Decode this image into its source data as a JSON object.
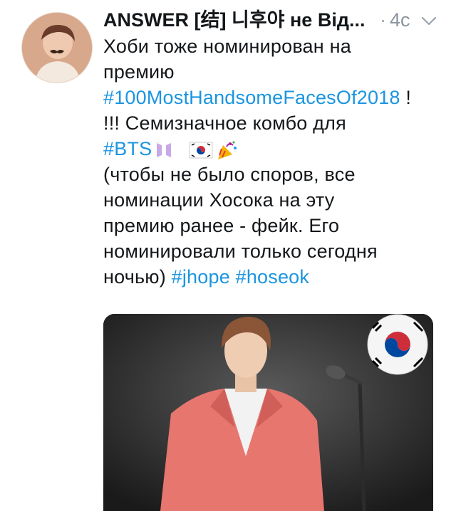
{
  "tweet": {
    "author_name": "ANSWER [结] 니후야 не Від...",
    "separator": "·",
    "time": "4с",
    "lines": [
      {
        "parts": [
          {
            "t": "text",
            "v": "Хоби тоже номинирован на"
          }
        ]
      },
      {
        "parts": [
          {
            "t": "text",
            "v": "премию"
          }
        ]
      },
      {
        "parts": [
          {
            "t": "tag",
            "v": "#100MostHandsomeFacesOf2018"
          },
          {
            "t": "text",
            "v": " !"
          }
        ]
      },
      {
        "parts": [
          {
            "t": "text",
            "v": "!!! Семизначное комбо для"
          }
        ]
      },
      {
        "parts": [
          {
            "t": "tag",
            "v": "#BTS"
          }
        ]
      },
      {
        "parts": [
          {
            "t": "text",
            "v": "(чтобы не было споров, все"
          }
        ]
      },
      {
        "parts": [
          {
            "t": "text",
            "v": "номинации Хосока на эту"
          }
        ]
      },
      {
        "parts": [
          {
            "t": "text",
            "v": "премию ранее - фейк. Его"
          }
        ]
      },
      {
        "parts": [
          {
            "t": "text",
            "v": "номинировали только сегодня"
          }
        ]
      },
      {
        "parts": [
          {
            "t": "text",
            "v": "ночью) "
          },
          {
            "t": "tag",
            "v": "#jhope"
          },
          {
            "t": "text",
            "v": " "
          },
          {
            "t": "tag",
            "v": "#hoseok"
          }
        ]
      }
    ],
    "icons": {
      "bts_logo": "bts-logo-icon",
      "flag": "south-korea-flag-icon",
      "party": "party-popper-icon",
      "chevron": "chevron-down-icon"
    },
    "colors": {
      "hashtag": "#1b95e0",
      "bts_logo": "#c9a8e8",
      "jacket": "#e7766f",
      "meta": "#8a949e"
    }
  }
}
